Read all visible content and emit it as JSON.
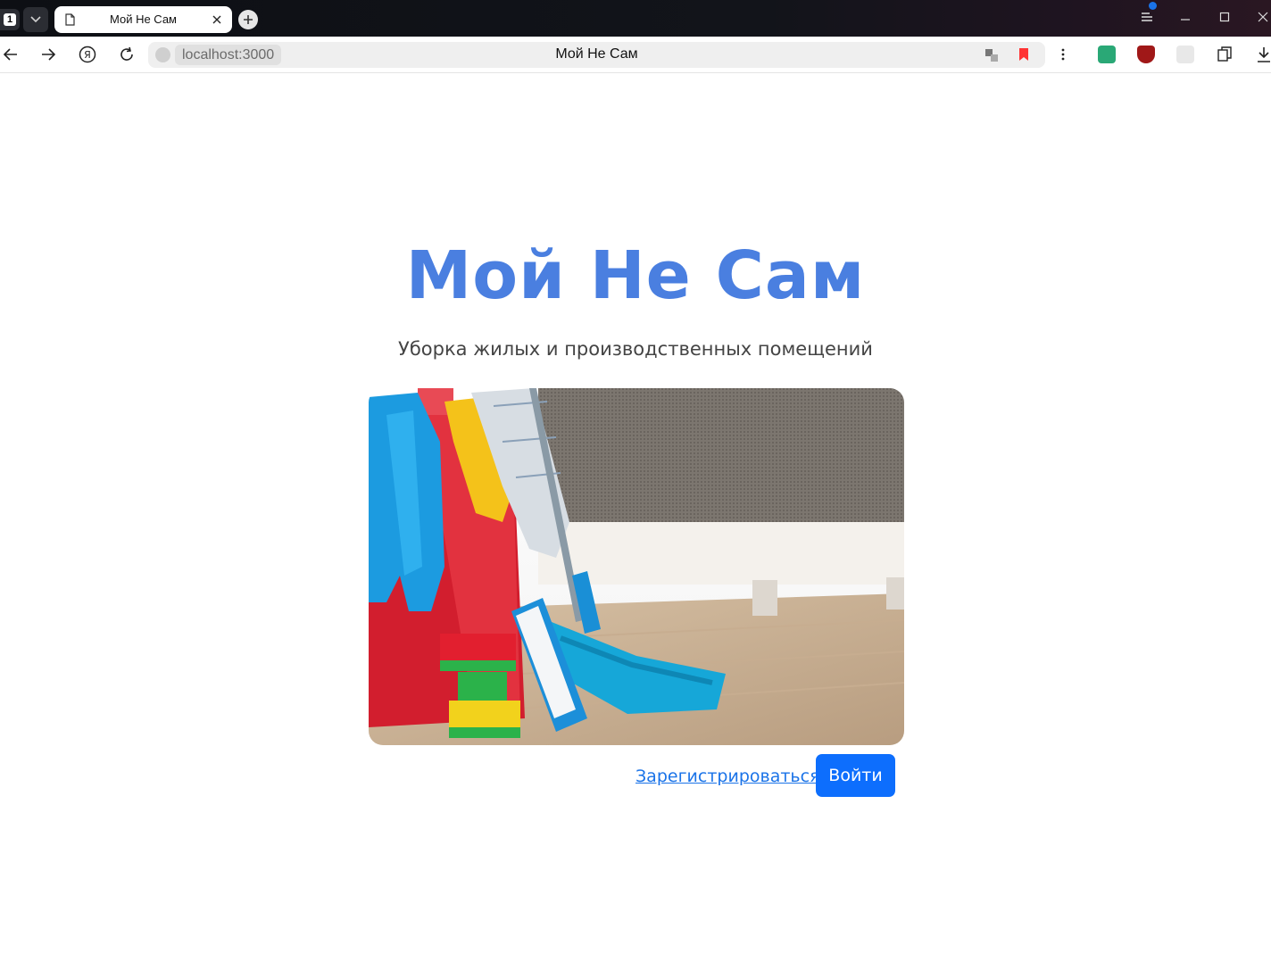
{
  "browser": {
    "tab_count": "1",
    "tab_title": "Мой Не Сам",
    "url": "localhost:3000",
    "page_title": "Мой Не Сам"
  },
  "page": {
    "title": "Мой Не Сам",
    "subtitle": "Уборка жилых и производственных помещений",
    "register_label": "Зарегистрироваться",
    "login_label": "Войти"
  },
  "colors": {
    "title_color": "#4a7fe0",
    "button_color": "#0d6efd",
    "link_color": "#1a73e8"
  },
  "icons": [
    "page-icon",
    "close-icon",
    "plus-icon",
    "back-icon",
    "forward-icon",
    "yandex-icon",
    "reload-icon",
    "translate-icon",
    "bookmark-icon",
    "more-icon",
    "download-icon"
  ]
}
